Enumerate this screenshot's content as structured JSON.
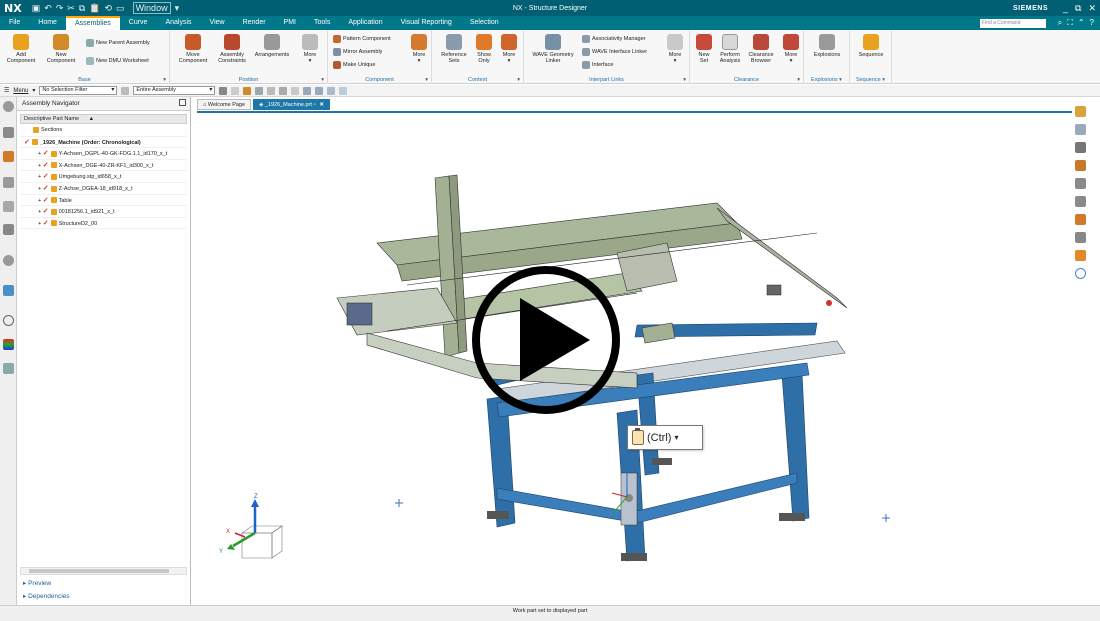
{
  "titlebar": {
    "app_logo": "NX",
    "window_menu": "Window",
    "title": "NX - Structure Designer",
    "brand": "SIEMENS",
    "controls": [
      "_",
      "⧉",
      "✕"
    ]
  },
  "menubar": {
    "tabs": [
      "File",
      "Home",
      "Assemblies",
      "Curve",
      "Analysis",
      "View",
      "Render",
      "PMI",
      "Tools",
      "Application",
      "Visual Reporting",
      "Selection"
    ],
    "active_tab": "Assemblies",
    "find_placeholder": "Find a Command"
  },
  "ribbon": {
    "groups": {
      "base": "Base",
      "position": "Position",
      "component": "Component",
      "context": "Context",
      "interpart_links": "Interpart Links",
      "clearance": "Clearance",
      "explosions": "Explosions",
      "sequence": "Sequence"
    },
    "buttons": {
      "add_component": [
        "Add",
        "Component"
      ],
      "new_component": [
        "New",
        "Component"
      ],
      "new_parent_assembly": "New Parent Assembly",
      "new_dmu_worksheet": "New DMU Worksheet",
      "move_component": [
        "Move",
        "Component"
      ],
      "assembly_constraints": [
        "Assembly",
        "Constraints"
      ],
      "arrangements": "Arrangements",
      "more_1": "More",
      "pattern_component": "Pattern Component",
      "mirror_assembly": "Mirror Assembly",
      "make_unique": "Make Unique",
      "more_2": "More",
      "reference_sets": [
        "Reference",
        "Sets"
      ],
      "show_only": [
        "Show",
        "Only"
      ],
      "more_3": "More",
      "wave_geometry_linker": [
        "WAVE Geometry",
        "Linker"
      ],
      "associativity_manager": "Associativity Manager",
      "wave_interface_linker": "WAVE Interface Linker",
      "interface": "Interface",
      "more_4": "More",
      "new_set": [
        "New",
        "Set"
      ],
      "perform_analysis": [
        "Perform",
        "Analysis"
      ],
      "clearance_browser": [
        "Clearance",
        "Browser"
      ],
      "more_5": "More",
      "explosions": "Explosions",
      "sequence": "Sequence"
    }
  },
  "toolbar": {
    "menu_label": "Menu",
    "selection_filter": "No Selection Filter",
    "scope": "Entire Assembly"
  },
  "navigator": {
    "title": "Assembly Navigator",
    "column_header": "Descriptive Part Name",
    "items": [
      {
        "label": "Sections",
        "indent": 1,
        "bold": false,
        "check": false
      },
      {
        "label": "_1926_Machine (Order: Chronological)",
        "indent": 0,
        "bold": true,
        "check": true
      },
      {
        "label": "Y-Achsen_DGPL-40-GK-FDG.1.1_id170_x_t",
        "indent": 2,
        "bold": false,
        "check": true
      },
      {
        "label": "X-Achsen_DGE-40-ZR-KF1_id300_x_t",
        "indent": 2,
        "bold": false,
        "check": true
      },
      {
        "label": "Umgebung.stp_id658_x_t",
        "indent": 2,
        "bold": false,
        "check": true
      },
      {
        "label": "Z-Achse_DGEA-18_id918_x_t",
        "indent": 2,
        "bold": false,
        "check": true
      },
      {
        "label": "Table",
        "indent": 2,
        "bold": false,
        "check": true
      },
      {
        "label": "00181256.1_id921_x_t",
        "indent": 2,
        "bold": false,
        "check": true
      },
      {
        "label": "StructureD2_00",
        "indent": 2,
        "bold": false,
        "check": true
      }
    ],
    "preview_link": "Preview",
    "dependencies_link": "Dependencies"
  },
  "doctabs": {
    "welcome": "Welcome Page",
    "part": "_1926_Machine.prt"
  },
  "viewport": {
    "triad_labels": {
      "z": "Z",
      "x": "X",
      "y": "Y"
    },
    "paste_hint": "(Ctrl)"
  },
  "status": {
    "message": "Work part set to displayed part"
  },
  "colors": {
    "title_bar": "#005f73",
    "menu_bar": "#00788a",
    "active_tab_accent": "#ffa600",
    "frame_blue": "#2e6fa8",
    "machine_green": "#a9b79a"
  }
}
